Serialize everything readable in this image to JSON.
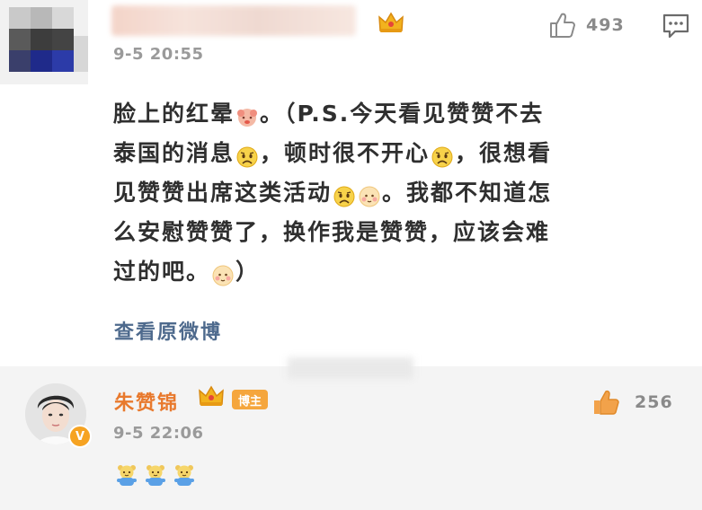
{
  "comment": {
    "timestamp": "9-5 20:55",
    "like_count": "493",
    "lines": [
      {
        "segments": [
          {
            "t": "text",
            "v": "脸上的红晕"
          },
          {
            "t": "emoji",
            "name": "blush-flower"
          },
          {
            "t": "text",
            "v": "。（P.S.今天看见赞赞不去"
          }
        ]
      },
      {
        "segments": [
          {
            "t": "text",
            "v": "泰国的消息"
          },
          {
            "t": "emoji",
            "name": "sad"
          },
          {
            "t": "text",
            "v": "，顿时很不开心"
          },
          {
            "t": "emoji",
            "name": "sad"
          },
          {
            "t": "text",
            "v": "，很想看"
          }
        ]
      },
      {
        "segments": [
          {
            "t": "text",
            "v": "见赞赞出席这类活动"
          },
          {
            "t": "emoji",
            "name": "sad"
          },
          {
            "t": "emoji",
            "name": "shy"
          },
          {
            "t": "text",
            "v": "。我都不知道怎"
          }
        ]
      },
      {
        "segments": [
          {
            "t": "text",
            "v": "么安慰赞赞了，换作我是赞赞，应该会难"
          }
        ]
      },
      {
        "segments": [
          {
            "t": "text",
            "v": "过的吧。"
          },
          {
            "t": "emoji",
            "name": "shy"
          },
          {
            "t": "text",
            "v": "）"
          }
        ]
      }
    ],
    "view_original_label": "查看原微博"
  },
  "reply": {
    "username": "朱赞锦",
    "badge_label": "博主",
    "timestamp": "9-5 22:06",
    "like_count": "256",
    "emoji_count": 3,
    "emoji_name": "blue-bear-emoji"
  },
  "colors": {
    "name_orange": "#e8792d",
    "link_blue": "#4e6a8d",
    "badge_orange": "#f5a63d",
    "reply_bg": "#f4f4f4"
  }
}
